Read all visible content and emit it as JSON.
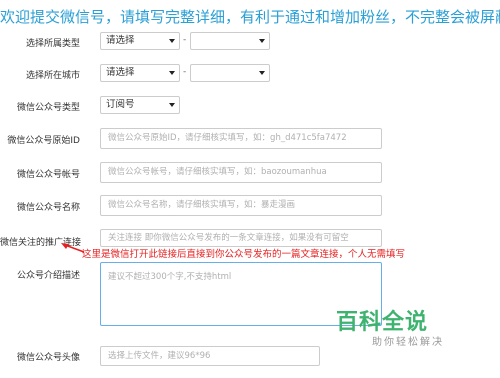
{
  "banner": "欢迎提交微信号，请填写完整详细，有利于通过和增加粉丝，不完整会被屏蔽！",
  "category": {
    "label": "选择所属类型",
    "select1": "请选择",
    "select2": "",
    "dash": "-"
  },
  "city": {
    "label": "选择所在城市",
    "select1": "请选择",
    "select2": "",
    "dash": "-"
  },
  "account_type": {
    "label": "微信公众号类型",
    "value": "订阅号"
  },
  "original_id": {
    "label": "微信公众号原始ID",
    "placeholder": "微信公众号原始ID，请仔细核实填写，如：gh_d471c5fa7472"
  },
  "account": {
    "label": "微信公众号帐号",
    "placeholder": "微信公众号帐号，请仔细核实填写，如：baozoumanhua"
  },
  "name": {
    "label": "微信公众号名称",
    "placeholder": "微信公众号名称，请仔细核实填写，如：暴走漫画"
  },
  "follow_link": {
    "label": "微信关注的推广连接",
    "placeholder": "关注连接 即你微信公众号发布的一条文章连接，如果没有可留空"
  },
  "annotation": "这里是微信打开此链接后直接到你公众号发布的一篇文章连接，个人无需填写",
  "intro": {
    "label": "公众号介绍描述",
    "placeholder": "建议不超过300个字,不支持html"
  },
  "avatar": {
    "label": "微信公众号头像",
    "placeholder": "选择上传文件，建议96*96"
  },
  "watermark": {
    "title": "百科全说",
    "subtitle": "助你轻松解决"
  },
  "colors": {
    "banner": "#2a9fd6",
    "annotation": "#e62020",
    "watermark": "#3eb370"
  }
}
